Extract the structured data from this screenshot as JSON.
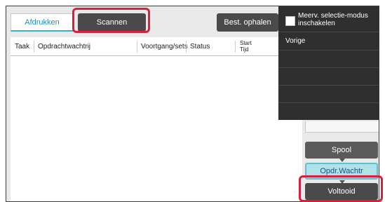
{
  "tabs": {
    "print": "Afdrukken",
    "scan": "Scannen",
    "fetch": "Best. ophalen"
  },
  "icons": {
    "more": "chevron-right-icon"
  },
  "table": {
    "headers": {
      "task": "Taak",
      "queue": "Opdrachtwachtrij",
      "progress": "Voortgang/sets",
      "status": "Status",
      "start_top": "Start",
      "start_bottom": "Tijd"
    }
  },
  "menu": {
    "multi_select": "Meerv. selectie-modus inschakelen",
    "back": "Vorige"
  },
  "side": {
    "spool": "Spool",
    "queue": "Opdr.Wachtr",
    "done": "Voltooid"
  },
  "colors": {
    "highlight": "#d81f3c",
    "accent": "#3ab0c9",
    "selected_fill": "#aee3ea"
  }
}
